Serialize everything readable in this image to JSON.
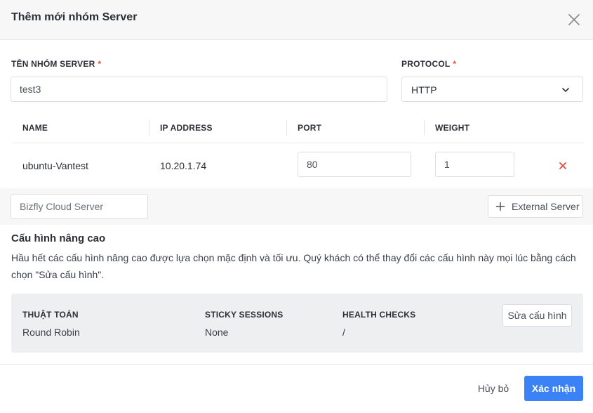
{
  "dialog": {
    "title": "Thêm mới nhóm Server"
  },
  "form": {
    "group_name_label": "TÊN NHÓM SERVER",
    "group_name_required": "*",
    "group_name_value": "test3",
    "protocol_label": "PROTOCOL",
    "protocol_required": "*",
    "protocol_value": "HTTP"
  },
  "table": {
    "headers": [
      "NAME",
      "IP ADDRESS",
      "PORT",
      "WEIGHT"
    ],
    "rows": [
      {
        "name": "ubuntu-Vantest",
        "ip": "10.20.1.74",
        "port": "80",
        "weight": "1"
      }
    ]
  },
  "add_server": {
    "search_placeholder": "Bizfly Cloud Server",
    "external_button": "External Server"
  },
  "advanced": {
    "title": "Cấu hình nâng cao",
    "description": "Hầu hết các cấu hình nâng cao được lựa chọn mặc định và tối ưu. Quý khách có thể thay đổi các cấu hình này mọi lúc bằng cách chọn \"Sửa cấu hình\".",
    "algorithm_label": "THUẬT TOÁN",
    "algorithm_value": "Round Robin",
    "sticky_label": "STICKY SESSIONS",
    "sticky_value": "None",
    "health_label": "HEALTH CHECKS",
    "health_value": "/",
    "edit_button": "Sửa cấu hình"
  },
  "footer": {
    "cancel_button": "Hủy bỏ",
    "confirm_button": "Xác nhận"
  },
  "icons": {
    "close": "close-icon",
    "dropdown": "chevron-down-icon",
    "remove": "remove-icon",
    "add": "plus-icon"
  },
  "colors": {
    "primary": "#3b82f6",
    "danger": "#e5483f",
    "header_bg": "#f7f7f8",
    "panel_bg": "#eeeff1"
  }
}
